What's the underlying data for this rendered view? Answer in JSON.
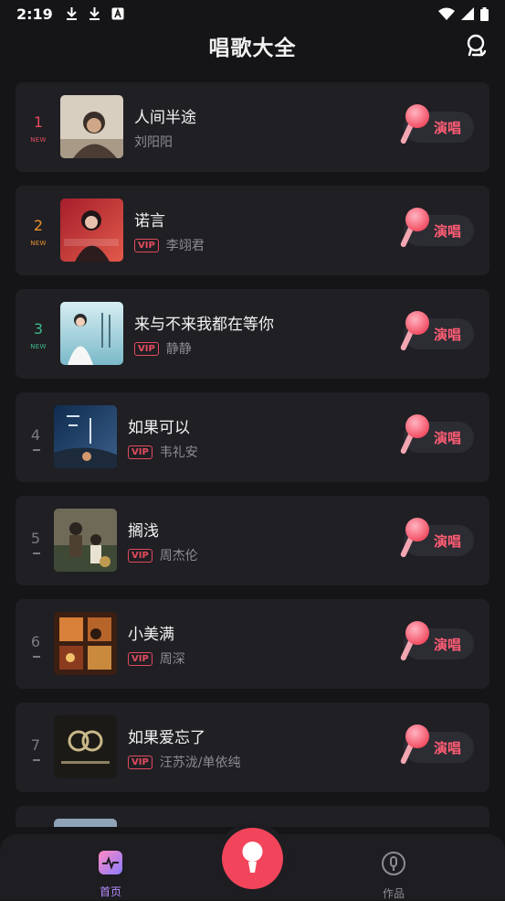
{
  "status": {
    "time": "2:19"
  },
  "header": {
    "title": "唱歌大全"
  },
  "songs": [
    {
      "rank": "1",
      "tag": "NEW",
      "rank_color": "#e34b5d",
      "title": "人间半途",
      "vip": "",
      "artist": "刘阳阳"
    },
    {
      "rank": "2",
      "tag": "NEW",
      "rank_color": "#e8922f",
      "title": "诺言",
      "vip": "VIP",
      "artist": "李翊君"
    },
    {
      "rank": "3",
      "tag": "NEW",
      "rank_color": "#3fb98a",
      "title": "来与不来我都在等你",
      "vip": "VIP",
      "artist": "静静"
    },
    {
      "rank": "4",
      "tag": "",
      "rank_color": "#7a7a80",
      "title": "如果可以",
      "vip": "VIP",
      "artist": "韦礼安"
    },
    {
      "rank": "5",
      "tag": "",
      "rank_color": "#7a7a80",
      "title": "搁浅",
      "vip": "VIP",
      "artist": "周杰伦"
    },
    {
      "rank": "6",
      "tag": "",
      "rank_color": "#7a7a80",
      "title": "小美满",
      "vip": "VIP",
      "artist": "周深"
    },
    {
      "rank": "7",
      "tag": "",
      "rank_color": "#7a7a80",
      "title": "如果爱忘了",
      "vip": "VIP",
      "artist": "汪苏泷/单依纯"
    }
  ],
  "sing_label": "演唱",
  "tabs": {
    "home": "首页",
    "works": "作品"
  },
  "colors": {
    "accent": "#f2455b",
    "vip": "#e34b5d",
    "home_tab": "#b68cff"
  }
}
